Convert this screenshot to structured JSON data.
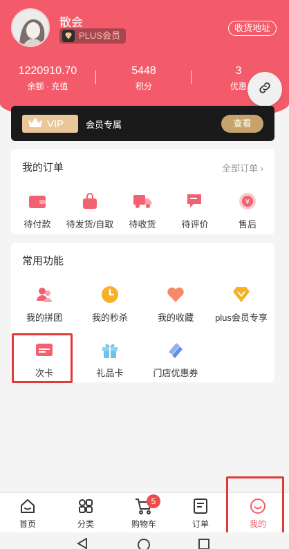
{
  "profile": {
    "name": "散会",
    "badge": "PLUS会员",
    "address_button": "收货地址"
  },
  "stats": [
    {
      "value": "1220910.70",
      "label": "余额 · 充值"
    },
    {
      "value": "5448",
      "label": "积分"
    },
    {
      "value": "3",
      "label": "优惠"
    }
  ],
  "vip": {
    "tag": "VIP",
    "text": "会员专属",
    "button": "查看"
  },
  "orders": {
    "title": "我的订单",
    "more": "全部订单 ›",
    "items": [
      {
        "label": "待付款",
        "icon": "wallet-icon"
      },
      {
        "label": "待发货/自取",
        "icon": "bag-icon"
      },
      {
        "label": "待收货",
        "icon": "truck-icon"
      },
      {
        "label": "待评价",
        "icon": "comment-icon"
      },
      {
        "label": "售后",
        "icon": "refund-icon"
      }
    ]
  },
  "functions": {
    "title": "常用功能",
    "items": [
      {
        "label": "我的拼团",
        "icon": "group-buy-icon"
      },
      {
        "label": "我的秒杀",
        "icon": "clock-icon"
      },
      {
        "label": "我的收藏",
        "icon": "heart-icon"
      },
      {
        "label": "plus会员专享",
        "icon": "diamond-icon"
      },
      {
        "label": "次卡",
        "icon": "card-icon"
      },
      {
        "label": "礼品卡",
        "icon": "gift-icon"
      },
      {
        "label": "门店优惠券",
        "icon": "coupon-icon"
      }
    ]
  },
  "tabbar": {
    "items": [
      {
        "label": "首页",
        "icon": "home-icon"
      },
      {
        "label": "分类",
        "icon": "category-icon"
      },
      {
        "label": "购物车",
        "icon": "cart-icon",
        "badge": "5"
      },
      {
        "label": "订单",
        "icon": "order-icon"
      },
      {
        "label": "我的",
        "icon": "profile-icon",
        "active": true
      }
    ]
  },
  "colors": {
    "brand": "#f45b6a",
    "vip_gold": "#e9c79a",
    "highlight": "#e13a36"
  }
}
